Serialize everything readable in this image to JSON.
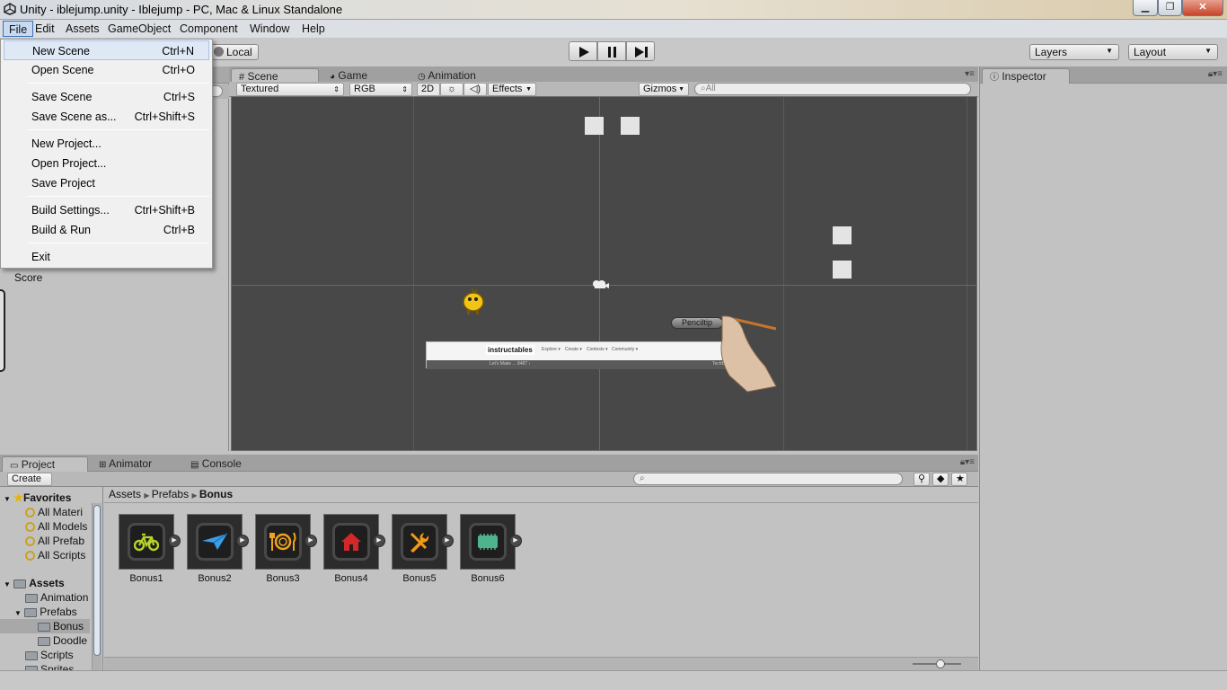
{
  "window": {
    "title": "Unity - iblejump.unity - Iblejump - PC, Mac & Linux Standalone",
    "minimize": "▁",
    "maximize": "❐",
    "close": "✕"
  },
  "menubar": {
    "items": [
      "File",
      "Edit",
      "Assets",
      "GameObject",
      "Component",
      "Window",
      "Help"
    ]
  },
  "toolbar": {
    "pivot_mode": "Local",
    "play_icon": "play-icon",
    "pause_icon": "pause-icon",
    "step_icon": "step-icon",
    "layers": "Layers",
    "layout": "Layout"
  },
  "file_menu": {
    "items": [
      {
        "label": "New Scene",
        "shortcut": "Ctrl+N"
      },
      {
        "label": "Open Scene",
        "shortcut": "Ctrl+O"
      },
      {
        "label": "Save Scene",
        "shortcut": "Ctrl+S"
      },
      {
        "label": "Save Scene as...",
        "shortcut": "Ctrl+Shift+S"
      },
      {
        "label": "New Project...",
        "shortcut": ""
      },
      {
        "label": "Open Project...",
        "shortcut": ""
      },
      {
        "label": "Save Project",
        "shortcut": ""
      },
      {
        "label": "Build Settings...",
        "shortcut": "Ctrl+Shift+B"
      },
      {
        "label": "Build & Run",
        "shortcut": "Ctrl+B"
      },
      {
        "label": "Exit",
        "shortcut": ""
      }
    ]
  },
  "hierarchy": {
    "visible_item": "Score"
  },
  "scene_panel": {
    "tabs": [
      "Scene",
      "Game",
      "Animation"
    ],
    "render_mode": "Textured",
    "color_mode": "RGB",
    "mode_2d": "2D",
    "effects": "Effects",
    "gizmos": "Gizmos",
    "search_placeholder": "All",
    "objects": {
      "character_label": "Penciltip",
      "banner_logo": "instructables",
      "banner_menu": [
        "Explore ▾",
        "Create ▾",
        "Contests ▾",
        "Community ▾"
      ],
      "banner_sub": "Let's Make ... 8487 ›",
      "banner_right": "TechBlog"
    }
  },
  "inspector": {
    "tab": "Inspector"
  },
  "project_panel": {
    "tabs": [
      "Project",
      "Animator",
      "Console"
    ],
    "create": "Create",
    "search_placeholder": "",
    "breadcrumb": [
      "Assets",
      "Prefabs",
      "Bonus"
    ],
    "favorites_label": "Favorites",
    "favorites": [
      "All Materi",
      "All Models",
      "All Prefab",
      "All Scripts"
    ],
    "assets_label": "Assets",
    "folders": [
      {
        "label": "Animation",
        "level": 1
      },
      {
        "label": "Prefabs",
        "level": 1
      },
      {
        "label": "Bonus",
        "level": 2
      },
      {
        "label": "Doodle",
        "level": 2
      },
      {
        "label": "Scripts",
        "level": 1
      },
      {
        "label": "Sprites",
        "level": 1
      }
    ],
    "assets": [
      {
        "name": "Bonus1",
        "icon": "bicycle-icon",
        "color": "#b9d12a"
      },
      {
        "name": "Bonus2",
        "icon": "paper-plane-icon",
        "color": "#3a9ee8"
      },
      {
        "name": "Bonus3",
        "icon": "plate-cutlery-icon",
        "color": "#f0a21e"
      },
      {
        "name": "Bonus4",
        "icon": "house-icon",
        "color": "#d42727"
      },
      {
        "name": "Bonus5",
        "icon": "wrench-screwdriver-icon",
        "color": "#f39a16"
      },
      {
        "name": "Bonus6",
        "icon": "chip-icon",
        "color": "#4fb38d"
      }
    ]
  }
}
